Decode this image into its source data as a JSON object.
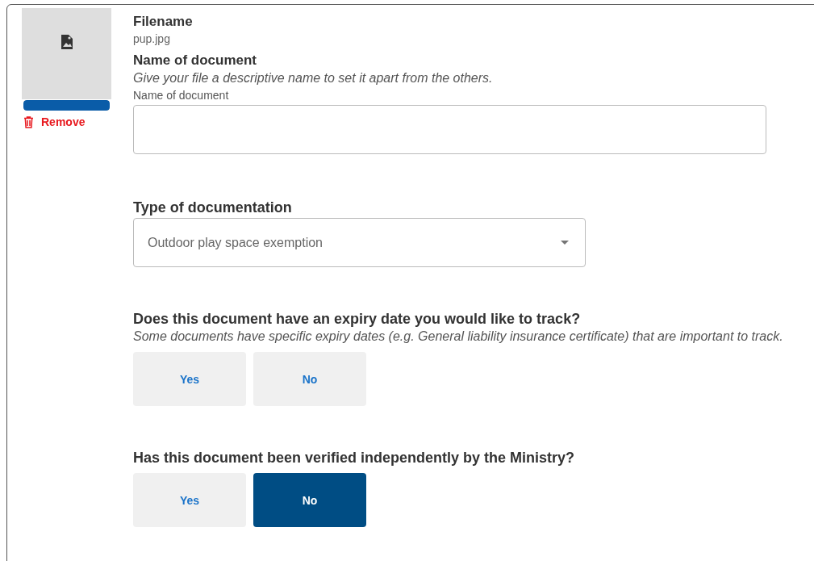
{
  "file": {
    "level": 1,
    "remove_label": "Remove",
    "filename_heading": "Filename",
    "filename": "pup.jpg"
  },
  "name_field": {
    "heading": "Name of document",
    "hint": "Give your file a descriptive name to set it apart from the others.",
    "label": "Name of document"
  },
  "type_field": {
    "heading": "Type of documentation",
    "value": "Outdoor play space exemption"
  },
  "questions": [
    {
      "question": "Does this document have an expiry date you would like to track?",
      "hint": "Some documents have specific expiry dates (e.g. General liability insurance certificate) that are important to track.",
      "options": [
        {
          "label": "Yes",
          "selected": false
        },
        {
          "label": "No",
          "selected": false
        }
      ]
    },
    {
      "question": "Has this document been verified independently by the Ministry?",
      "options": [
        {
          "label": "Yes",
          "selected": false
        },
        {
          "label": "No",
          "selected": true
        }
      ]
    }
  ]
}
